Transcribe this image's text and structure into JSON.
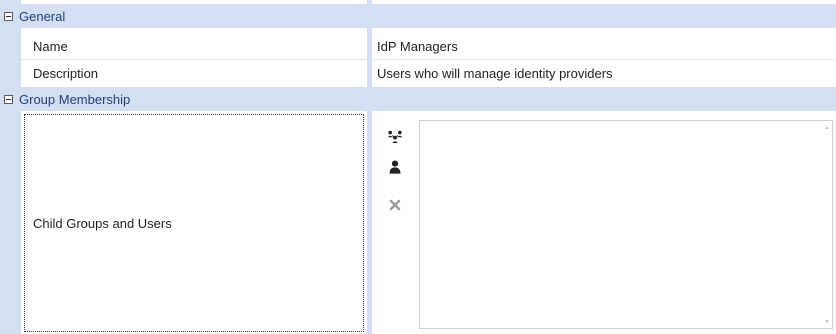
{
  "sections": {
    "general": {
      "title": "General"
    },
    "group_membership": {
      "title": "Group Membership"
    }
  },
  "properties": {
    "name": {
      "label": "Name",
      "value": "IdP Managers"
    },
    "description": {
      "label": "Description",
      "value": "Users who will manage identity providers"
    },
    "child_groups": {
      "label": "Child Groups and Users",
      "items": []
    }
  },
  "tools": {
    "add_group_icon": "group-icon",
    "add_user_icon": "user-icon",
    "remove_icon": "remove-x-icon"
  },
  "colors": {
    "category_bg": "#d4dff4",
    "category_text": "#1f3f7a"
  }
}
